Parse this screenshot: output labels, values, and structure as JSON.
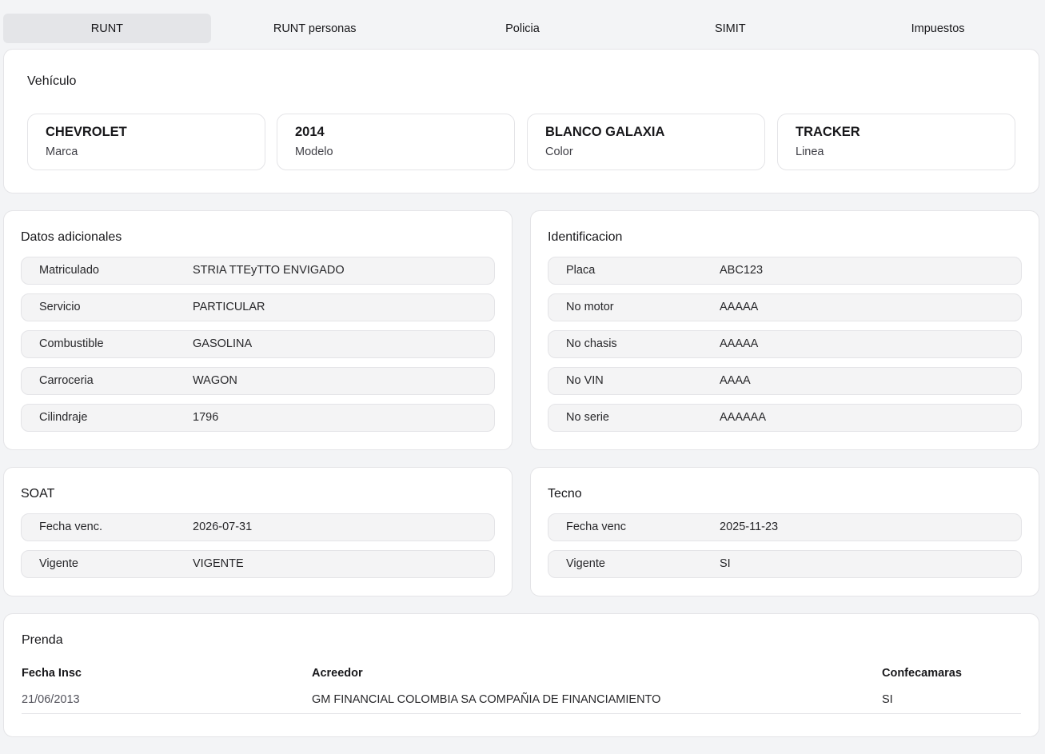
{
  "tabs": [
    {
      "label": "RUNT",
      "active": true
    },
    {
      "label": "RUNT personas",
      "active": false
    },
    {
      "label": "Policia",
      "active": false
    },
    {
      "label": "SIMIT",
      "active": false
    },
    {
      "label": "Impuestos",
      "active": false
    }
  ],
  "vehiculo": {
    "title": "Vehículo",
    "stats": [
      {
        "value": "CHEVROLET",
        "label": "Marca"
      },
      {
        "value": "2014",
        "label": "Modelo"
      },
      {
        "value": "BLANCO GALAXIA",
        "label": "Color"
      },
      {
        "value": "TRACKER",
        "label": "Linea"
      }
    ]
  },
  "datos_adicionales": {
    "title": "Datos adicionales",
    "rows": [
      {
        "key": "Matriculado",
        "value": "STRIA TTEyTTO ENVIGADO"
      },
      {
        "key": "Servicio",
        "value": "PARTICULAR"
      },
      {
        "key": "Combustible",
        "value": "GASOLINA"
      },
      {
        "key": "Carroceria",
        "value": "WAGON"
      },
      {
        "key": "Cilindraje",
        "value": "1796"
      }
    ]
  },
  "identificacion": {
    "title": "Identificacion",
    "rows": [
      {
        "key": "Placa",
        "value": "ABC123"
      },
      {
        "key": "No motor",
        "value": "AAAAA"
      },
      {
        "key": "No chasis",
        "value": "AAAAA"
      },
      {
        "key": "No VIN",
        "value": "AAAA"
      },
      {
        "key": "No serie",
        "value": "AAAAAA"
      }
    ]
  },
  "soat": {
    "title": "SOAT",
    "rows": [
      {
        "key": "Fecha venc.",
        "value": "2026-07-31"
      },
      {
        "key": "Vigente",
        "value": "VIGENTE"
      }
    ]
  },
  "tecno": {
    "title": "Tecno",
    "rows": [
      {
        "key": "Fecha venc",
        "value": "2025-11-23"
      },
      {
        "key": "Vigente",
        "value": "SI"
      }
    ]
  },
  "prenda": {
    "title": "Prenda",
    "headers": [
      "Fecha Insc",
      "Acreedor",
      "Confecamaras"
    ],
    "rows": [
      [
        "21/06/2013",
        "GM FINANCIAL COLOMBIA SA COMPAÑIA DE FINANCIAMIENTO",
        "SI"
      ]
    ]
  }
}
